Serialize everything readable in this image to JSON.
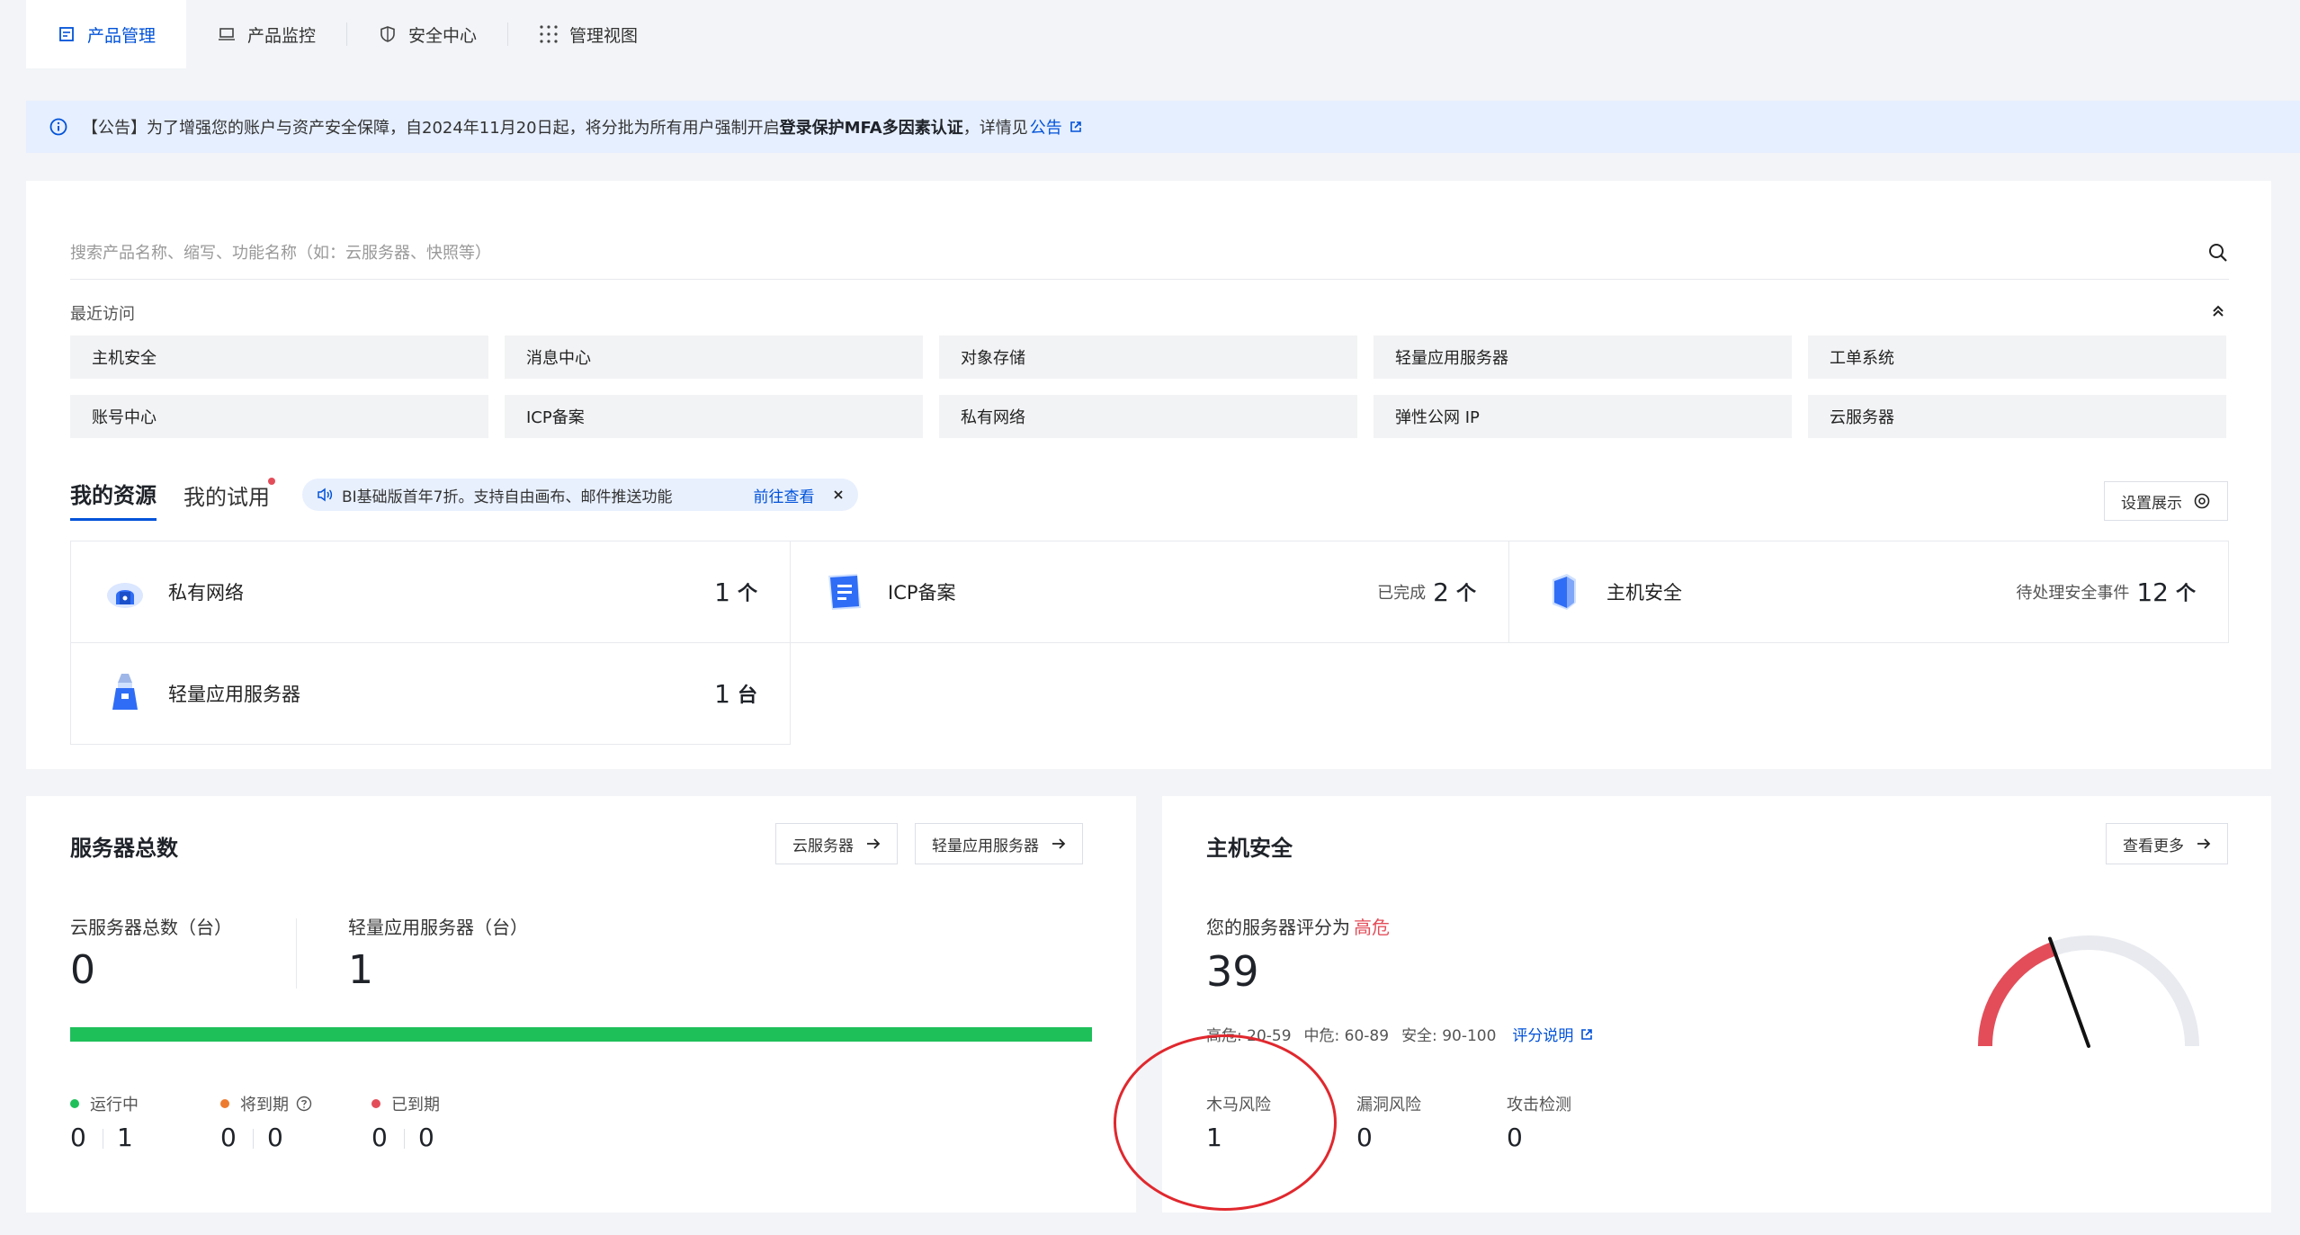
{
  "tabs": [
    {
      "label": "产品管理",
      "icon": "document-icon",
      "active": true
    },
    {
      "label": "产品监控",
      "icon": "monitor-icon",
      "active": false
    },
    {
      "label": "安全中心",
      "icon": "shield-icon",
      "active": false
    },
    {
      "label": "管理视图",
      "icon": "grid-dots-icon",
      "active": false
    }
  ],
  "notice": {
    "prefix": "【公告】为了增强您的账户与资产安全保障，自2024年11月20日起，将分批为所有用户强制开启",
    "bold": "登录保护MFA多因素认证",
    "suffix": "，详情见",
    "link": "公告"
  },
  "search": {
    "placeholder": "搜索产品名称、缩写、功能名称（如：云服务器、快照等）"
  },
  "recent": {
    "title": "最近访问",
    "items": [
      "主机安全",
      "消息中心",
      "对象存储",
      "轻量应用服务器",
      "工单系统",
      "账号中心",
      "ICP备案",
      "私有网络",
      "弹性公网 IP",
      "云服务器"
    ]
  },
  "resources": {
    "tab_mine": "我的资源",
    "tab_trial": "我的试用",
    "promo_text": "BI基础版首年7折。支持自由画布、邮件推送功能",
    "promo_link": "前往查看",
    "display_btn": "设置展示",
    "items": [
      {
        "name": "私有网络",
        "sub": "",
        "count": "1",
        "unit": "个"
      },
      {
        "name": "ICP备案",
        "sub": "已完成",
        "count": "2",
        "unit": "个"
      },
      {
        "name": "主机安全",
        "sub": "待处理安全事件",
        "count": "12",
        "unit": "个"
      },
      {
        "name": "轻量应用服务器",
        "sub": "",
        "count": "1",
        "unit": "台"
      }
    ]
  },
  "server": {
    "title": "服务器总数",
    "btn_cvm": "云服务器",
    "btn_lighthouse": "轻量应用服务器",
    "cvm_label": "云服务器总数（台）",
    "cvm_value": "0",
    "lh_label": "轻量应用服务器（台）",
    "lh_value": "1",
    "progress_fraction": 1.0,
    "colors": {
      "running": "#1ec05a",
      "expiring": "#ed7b2f",
      "expired": "#e34d59"
    },
    "legend": [
      {
        "label": "运行中",
        "a": "0",
        "b": "1"
      },
      {
        "label": "将到期",
        "a": "0",
        "b": "0"
      },
      {
        "label": "已到期",
        "a": "0",
        "b": "0"
      }
    ]
  },
  "host": {
    "title": "主机安全",
    "btn_more": "查看更多",
    "score_label": "您的服务器评分为",
    "score_level": "高危",
    "score": "39",
    "score_max": 100,
    "ranges": [
      "高危: 20-59",
      "中危: 60-89",
      "安全: 90-100"
    ],
    "ranges_link": "评分说明",
    "stats": [
      {
        "label": "木马风险",
        "value": "1"
      },
      {
        "label": "漏洞风险",
        "value": "0"
      },
      {
        "label": "攻击检测",
        "value": "0"
      }
    ]
  }
}
